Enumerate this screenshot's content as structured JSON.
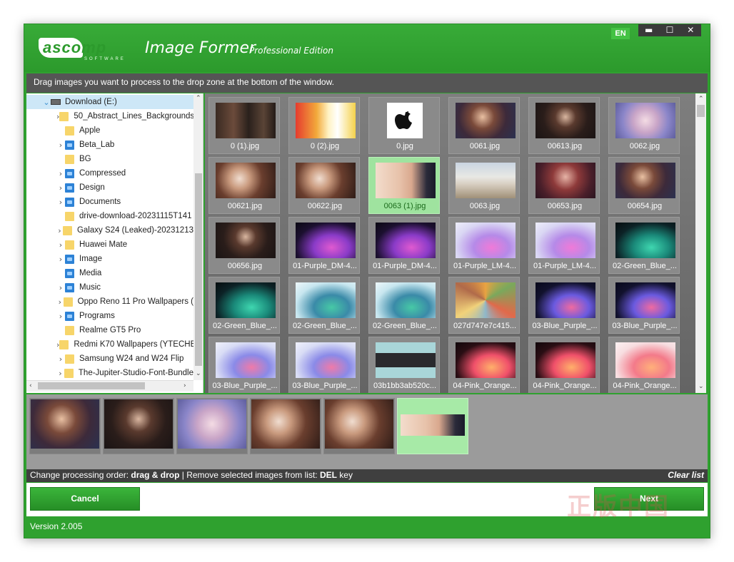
{
  "header": {
    "logo_text": "ascomp",
    "logo_sub": "SOFTWARE",
    "app_name": "Image Former",
    "edition": "Professional Edition",
    "lang": "EN",
    "controls": [
      "▬",
      "☐",
      "✕"
    ]
  },
  "instruction": "Drag images you want to process to the drop zone at the bottom of the window.",
  "tree": {
    "root": "Download (E:)",
    "folders": [
      {
        "label": "50_Abstract_Lines_Backgrounds",
        "expandable": true,
        "special": false
      },
      {
        "label": "Apple",
        "expandable": false,
        "special": false
      },
      {
        "label": "Beta_Lab",
        "expandable": true,
        "special": true
      },
      {
        "label": "BG",
        "expandable": false,
        "special": false
      },
      {
        "label": "Compressed",
        "expandable": true,
        "special": true
      },
      {
        "label": "Design",
        "expandable": true,
        "special": true
      },
      {
        "label": "Documents",
        "expandable": true,
        "special": true
      },
      {
        "label": "drive-download-20231115T141",
        "expandable": false,
        "special": false
      },
      {
        "label": "Galaxy S24 (Leaked)-20231213",
        "expandable": true,
        "special": false
      },
      {
        "label": "Huawei Mate",
        "expandable": true,
        "special": false
      },
      {
        "label": "Image",
        "expandable": true,
        "special": true
      },
      {
        "label": "Media",
        "expandable": false,
        "special": true
      },
      {
        "label": "Music",
        "expandable": true,
        "special": true
      },
      {
        "label": "Oppo Reno 11 Pro Wallpapers (",
        "expandable": true,
        "special": false
      },
      {
        "label": "Programs",
        "expandable": true,
        "special": true
      },
      {
        "label": "Realme GT5 Pro",
        "expandable": false,
        "special": false
      },
      {
        "label": "Redmi K70 Wallpapers (YTECHB",
        "expandable": true,
        "special": false
      },
      {
        "label": "Samsung W24 and W24 Flip",
        "expandable": true,
        "special": false
      },
      {
        "label": "The-Jupiter-Studio-Font-Bundle",
        "expandable": true,
        "special": false
      }
    ]
  },
  "images": [
    {
      "name": "0 (1).jpg",
      "thumb": "portrait-wide",
      "selected": false
    },
    {
      "name": "0 (2).jpg",
      "thumb": "cartoon-banner",
      "selected": false
    },
    {
      "name": "0.jpg",
      "thumb": "apple-logo",
      "selected": false
    },
    {
      "name": "0061.jpg",
      "thumb": "portrait-warm",
      "selected": false
    },
    {
      "name": "00613.jpg",
      "thumb": "portrait-dark",
      "selected": false
    },
    {
      "name": "0062.jpg",
      "thumb": "portrait-pastel",
      "selected": false
    },
    {
      "name": "00621.jpg",
      "thumb": "portrait-reading",
      "selected": false
    },
    {
      "name": "00622.jpg",
      "thumb": "portrait-reading",
      "selected": false
    },
    {
      "name": "0063 (1).jpg",
      "thumb": "portrait-lying",
      "selected": true
    },
    {
      "name": "0063.jpg",
      "thumb": "suv-desert",
      "selected": false
    },
    {
      "name": "00653.jpg",
      "thumb": "portrait-red",
      "selected": false
    },
    {
      "name": "00654.jpg",
      "thumb": "portrait-warm",
      "selected": false
    },
    {
      "name": "00656.jpg",
      "thumb": "portrait-dark",
      "selected": false
    },
    {
      "name": "01-Purple_DM-4...",
      "thumb": "tablet-purple-dark",
      "selected": false
    },
    {
      "name": "01-Purple_DM-4...",
      "thumb": "tablet-purple-dark",
      "selected": false
    },
    {
      "name": "01-Purple_LM-4...",
      "thumb": "tablet-purple-light",
      "selected": false
    },
    {
      "name": "01-Purple_LM-4...",
      "thumb": "tablet-purple-light",
      "selected": false
    },
    {
      "name": "02-Green_Blue_...",
      "thumb": "tablet-green-dark",
      "selected": false
    },
    {
      "name": "02-Green_Blue_...",
      "thumb": "tablet-green-dark",
      "selected": false
    },
    {
      "name": "02-Green_Blue_...",
      "thumb": "tablet-green-light",
      "selected": false
    },
    {
      "name": "02-Green_Blue_...",
      "thumb": "tablet-green-light",
      "selected": false
    },
    {
      "name": "027d747e7c415...",
      "thumb": "sticker-collage",
      "selected": false
    },
    {
      "name": "03-Blue_Purple_...",
      "thumb": "tablet-blue-dark",
      "selected": false
    },
    {
      "name": "03-Blue_Purple_...",
      "thumb": "tablet-blue-dark",
      "selected": false
    },
    {
      "name": "03-Blue_Purple_...",
      "thumb": "tablet-blue-light",
      "selected": false
    },
    {
      "name": "03-Blue_Purple_...",
      "thumb": "tablet-blue-light",
      "selected": false
    },
    {
      "name": "03b1bb3ab520c...",
      "thumb": "cassette",
      "selected": false
    },
    {
      "name": "04-Pink_Orange...",
      "thumb": "tablet-pink-dark",
      "selected": false
    },
    {
      "name": "04-Pink_Orange...",
      "thumb": "tablet-pink-dark",
      "selected": false
    },
    {
      "name": "04-Pink_Orange...",
      "thumb": "tablet-pink-light",
      "selected": false
    }
  ],
  "dropzone": [
    {
      "thumb": "portrait-warm",
      "selected": false
    },
    {
      "thumb": "portrait-dark",
      "selected": false
    },
    {
      "thumb": "portrait-pastel",
      "selected": false
    },
    {
      "thumb": "portrait-reading",
      "selected": false
    },
    {
      "thumb": "portrait-reading",
      "selected": false
    },
    {
      "thumb": "portrait-lying",
      "selected": true
    }
  ],
  "hint": {
    "part1": "Change processing order: ",
    "part1_bold": "drag & drop",
    "sep": " | Remove selected images from list: ",
    "part2_bold": "DEL",
    "part2": " key",
    "clear": "Clear list"
  },
  "buttons": {
    "cancel": "Cancel",
    "next": "Next"
  },
  "watermark": {
    "text": "正版中国",
    "url": "www.getitfree.cn"
  },
  "version": "Version 2.005"
}
